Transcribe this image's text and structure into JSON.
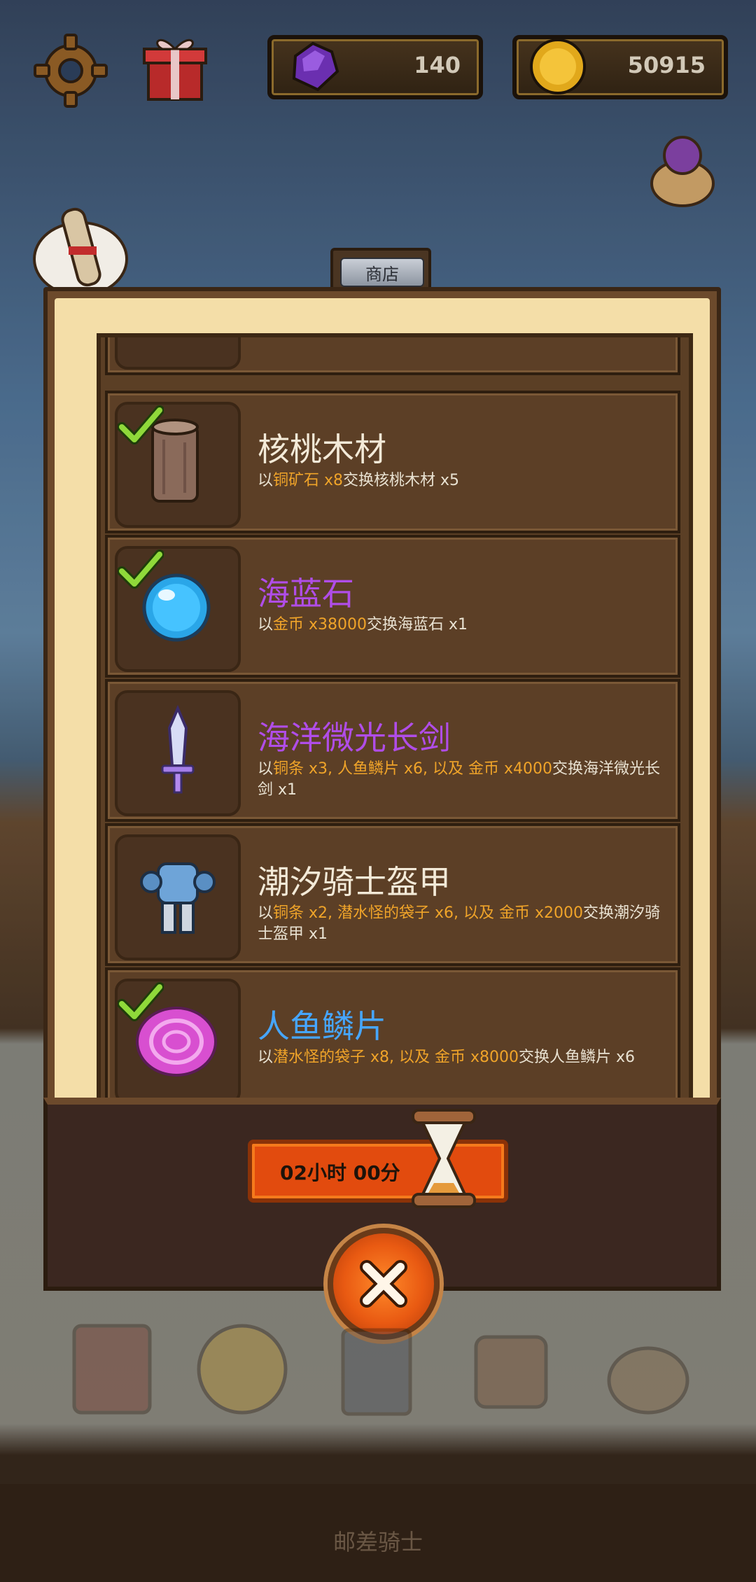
{
  "hud": {
    "gems": "140",
    "coins": "50915"
  },
  "shop": {
    "tab_label": "商店",
    "items": [
      {
        "name": "核桃木材",
        "desc_pre": "以",
        "desc_hl1": "铜矿石 x8",
        "desc_mid": "交换核桃木材 x5",
        "desc_hl2": "",
        "desc_post": "",
        "owned": true,
        "rarity_color": "#f3ead8",
        "icon": "wood-log-icon"
      },
      {
        "name": "海蓝石",
        "desc_pre": "以",
        "desc_hl1": "金币 x38000",
        "desc_mid": "交换海蓝石 x1",
        "desc_hl2": "",
        "desc_post": "",
        "owned": true,
        "rarity_color": "#b04de8",
        "icon": "aquamarine-orb-icon"
      },
      {
        "name": "海洋微光长剑",
        "desc_pre": "以",
        "desc_hl1": "铜条 x3, 人鱼鳞片 x6, 以及 金币 x4000",
        "desc_mid": "交换海洋微光长剑 x1",
        "desc_hl2": "",
        "desc_post": "",
        "owned": false,
        "rarity_color": "#b04de8",
        "icon": "sword-icon"
      },
      {
        "name": "潮汐骑士盔甲",
        "desc_pre": "以",
        "desc_hl1": "铜条 x2, 潜水怪的袋子 x6, 以及 金币 x2000",
        "desc_mid": "交换潮汐骑士盔甲 x1",
        "desc_hl2": "",
        "desc_post": "",
        "owned": false,
        "rarity_color": "#f3ead8",
        "icon": "armor-icon"
      },
      {
        "name": "人鱼鳞片",
        "desc_pre": "以",
        "desc_hl1": "潜水怪的袋子 x8, 以及 金币 x8000",
        "desc_mid": "交换人鱼鳞片 x6",
        "desc_hl2": "",
        "desc_post": "",
        "owned": true,
        "rarity_color": "#46a6ff",
        "icon": "mermaid-scale-icon"
      }
    ]
  },
  "timer": {
    "label": "02小时 00分"
  },
  "footer": {
    "label": "邮差骑士"
  },
  "colors": {
    "highlight": "#f0a429",
    "epic": "#b04de8",
    "rare": "#46a6ff",
    "accent_orange": "#e24b0e"
  }
}
